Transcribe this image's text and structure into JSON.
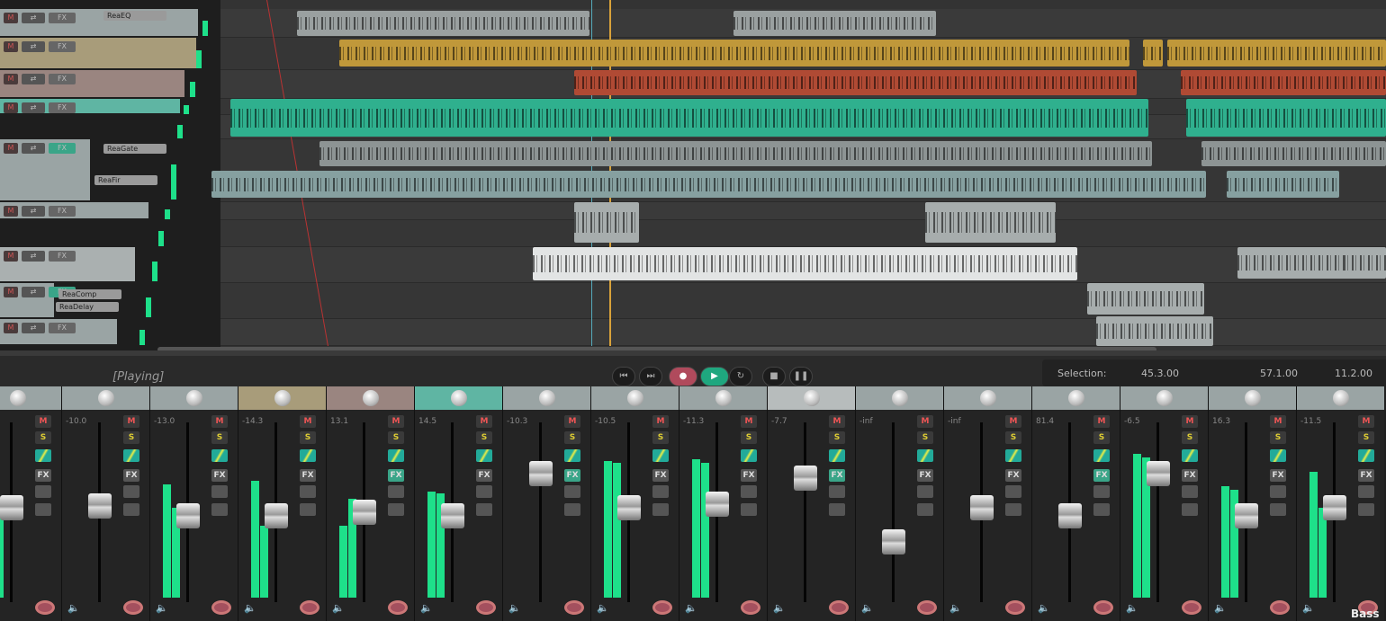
{
  "transport": {
    "status": "[Playing]",
    "selection_label": "Selection:",
    "selection_start": "45.3.00",
    "selection_end": "57.1.00",
    "selection_length": "11.2.00",
    "buttons": [
      {
        "name": "go-to-start",
        "glyph": "⏮"
      },
      {
        "name": "go-to-end",
        "glyph": "⏭"
      },
      {
        "name": "record",
        "glyph": "●"
      },
      {
        "name": "play",
        "glyph": "▶"
      },
      {
        "name": "repeat",
        "glyph": "↻"
      },
      {
        "name": "stop",
        "glyph": "■"
      },
      {
        "name": "pause",
        "glyph": "❚❚"
      }
    ]
  },
  "tracks": {
    "fx": [
      "ReaEQ",
      "ReaGate",
      "ReaFir",
      "ReaComp",
      "ReaDelay"
    ]
  },
  "mixer": {
    "strips": [
      {
        "db": "",
        "color": "#9aa4a4",
        "meter": [
          0.7,
          0.55
        ],
        "fader": 0.55
      },
      {
        "db": "-10.0",
        "color": "#9aa4a4",
        "meter": [
          0,
          0
        ],
        "fader": 0.56
      },
      {
        "db": "-13.0",
        "color": "#9aa4a4",
        "meter": [
          0.63,
          0.5
        ],
        "fader": 0.5
      },
      {
        "db": "-14.3",
        "color": "#a89c7a",
        "meter": [
          0.65,
          0.4
        ],
        "fader": 0.5
      },
      {
        "db": "13.1",
        "color": "#9a8580",
        "meter": [
          0.4,
          0.55
        ],
        "fader": 0.52
      },
      {
        "db": "14.5",
        "color": "#5fb5a3",
        "meter": [
          0.59,
          0.58
        ],
        "fader": 0.5
      },
      {
        "db": "-10.3",
        "color": "#9aa4a4",
        "meter": [
          0,
          0
        ],
        "fader": 0.75
      },
      {
        "db": "-10.5",
        "color": "#9aa4a4",
        "meter": [
          0.76,
          0.75
        ],
        "fader": 0.55
      },
      {
        "db": "-11.3",
        "color": "#9aa4a4",
        "meter": [
          0.77,
          0.75
        ],
        "fader": 0.57
      },
      {
        "db": "-7.7",
        "color": "#b7bcbc",
        "meter": [
          0,
          0
        ],
        "fader": 0.72
      },
      {
        "db": "-inf",
        "color": "#9aa4a4",
        "meter": [
          0,
          0
        ],
        "fader": 0.35
      },
      {
        "db": "-inf",
        "color": "#9aa4a4",
        "meter": [
          0,
          0
        ],
        "fader": 0.55
      },
      {
        "db": "81.4",
        "color": "#9aa4a4",
        "meter": [
          0,
          0
        ],
        "fader": 0.5
      },
      {
        "db": "-6.5",
        "color": "#9aa4a4",
        "meter": [
          0.8,
          0.78
        ],
        "fader": 0.75
      },
      {
        "db": "16.3",
        "color": "#9aa4a4",
        "meter": [
          0.62,
          0.6
        ],
        "fader": 0.5
      },
      {
        "db": "-11.5",
        "color": "#9aa4a4",
        "meter": [
          0.7,
          0.5
        ],
        "fader": 0.55,
        "name": "Bass"
      }
    ],
    "mute": "M",
    "solo": "S",
    "fx": "FX"
  }
}
